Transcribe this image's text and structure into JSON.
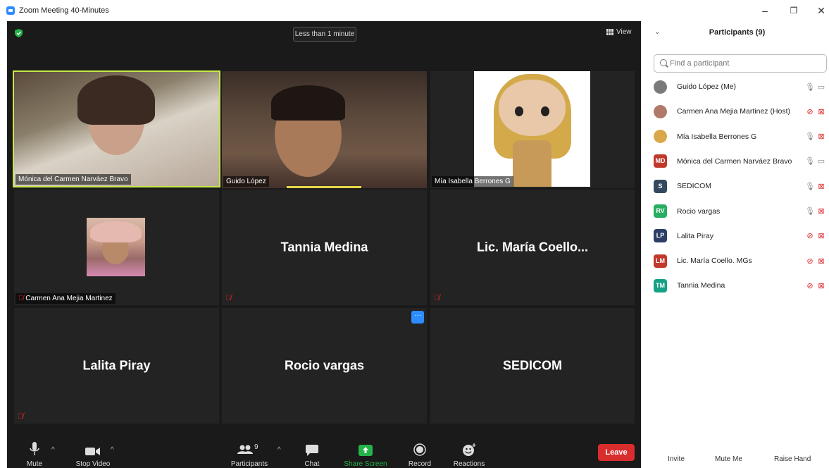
{
  "window": {
    "title": "Zoom Meeting 40-Minutes"
  },
  "meeting": {
    "timer": "Less than 1 minute",
    "view_label": "View",
    "tiles": [
      {
        "name": "Mónica del Carmen Narváez Bravo"
      },
      {
        "name": "Guido López"
      },
      {
        "name": "Mía Isabella Berrones G"
      },
      {
        "name": "Carmen Ana Mejia Martinez"
      },
      {
        "name": "Tannia Medina"
      },
      {
        "name": "Lic. María Coello..."
      },
      {
        "name": "Lalita Piray"
      },
      {
        "name": "Rocio vargas"
      },
      {
        "name": "SEDICOM"
      }
    ],
    "more_label": "···"
  },
  "toolbar": {
    "mute": "Mute",
    "stop_video": "Stop Video",
    "participants": "Participants",
    "participants_count": "9",
    "chat": "Chat",
    "share_screen": "Share Screen",
    "record": "Record",
    "reactions": "Reactions",
    "leave": "Leave"
  },
  "panel": {
    "title": "Participants (9)",
    "search_placeholder": "Find a participant",
    "participants": [
      {
        "name": "Guido López (Me)",
        "initials": "",
        "color": "#7a7a7a",
        "mic": "on",
        "video": "on"
      },
      {
        "name": "Carmen Ana Mejia Martinez (Host)",
        "initials": "",
        "color": "#b07a6a",
        "mic": "muted",
        "video": "off"
      },
      {
        "name": "Mía Isabella Berrones G",
        "initials": "",
        "color": "#d9a84a",
        "mic": "on",
        "video": "off"
      },
      {
        "name": "Mónica del Carmen Narváez Bravo",
        "initials": "MD",
        "color": "#c0392b",
        "mic": "on",
        "video": "on"
      },
      {
        "name": "SEDICOM",
        "initials": "S",
        "color": "#34495e",
        "mic": "on",
        "video": "off"
      },
      {
        "name": "Rocio vargas",
        "initials": "RV",
        "color": "#27ae60",
        "mic": "on",
        "video": "off"
      },
      {
        "name": "Lalita Piray",
        "initials": "LP",
        "color": "#2c3e66",
        "mic": "muted",
        "video": "off"
      },
      {
        "name": "Lic. María Coello. MGs",
        "initials": "LM",
        "color": "#c0392b",
        "mic": "muted",
        "video": "off"
      },
      {
        "name": "Tannia Medina",
        "initials": "TM",
        "color": "#16a085",
        "mic": "muted",
        "video": "off"
      }
    ],
    "invite": "Invite",
    "mute_me": "Mute Me",
    "raise_hand": "Raise Hand"
  }
}
